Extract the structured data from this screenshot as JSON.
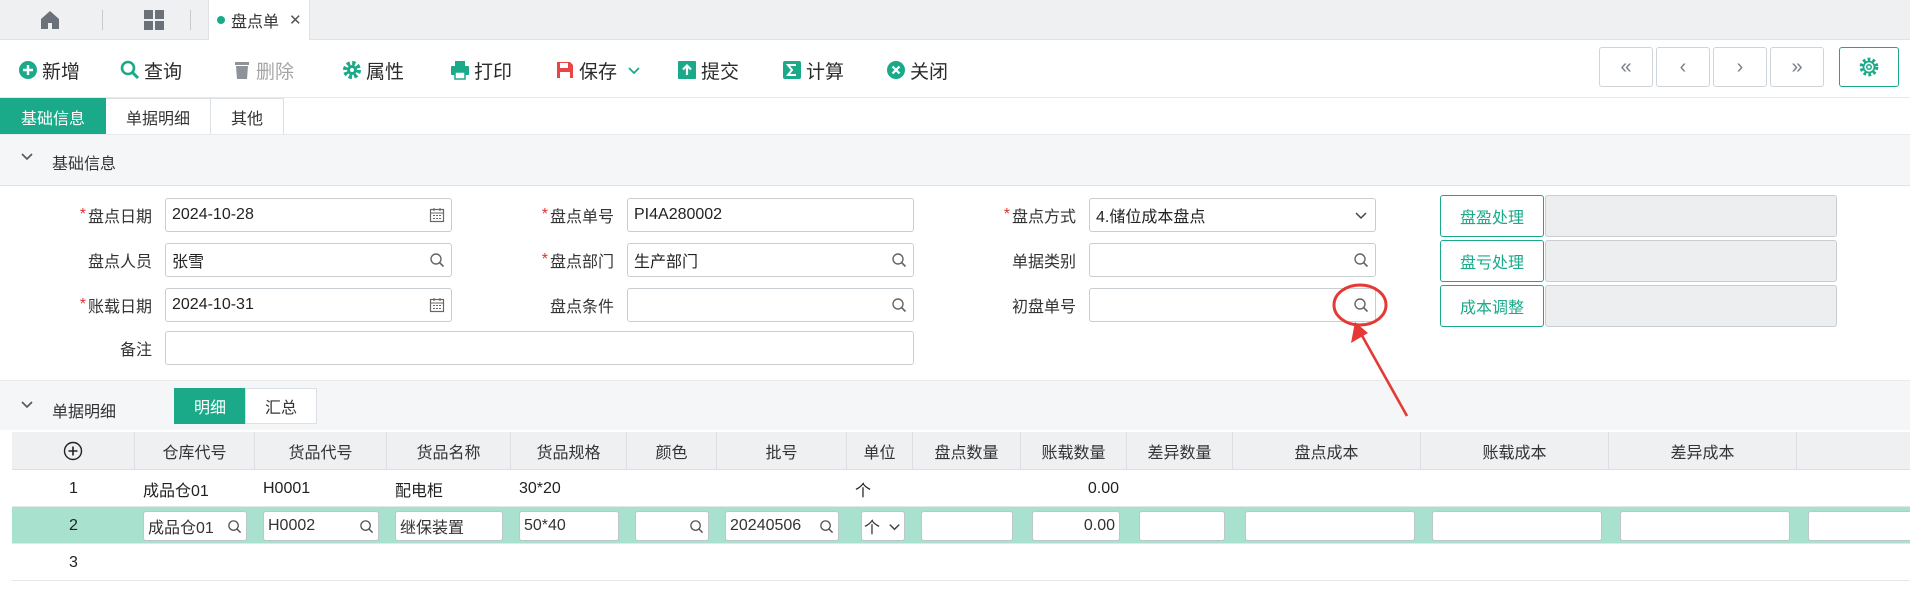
{
  "tabs": {
    "page_tab_label": "盘点单",
    "home_icon": "home-icon",
    "apps_icon": "grid-icon",
    "close_icon": "close-icon"
  },
  "toolbar": {
    "new": "新增",
    "query": "查询",
    "delete": "删除",
    "properties": "属性",
    "print": "打印",
    "save": "保存",
    "submit": "提交",
    "calculate": "计算",
    "close": "关闭",
    "nav": [
      "«",
      "‹",
      "›",
      "»"
    ]
  },
  "section_tabs": [
    "基础信息",
    "单据明细",
    "其他"
  ],
  "basic": {
    "title": "基础信息",
    "fields": {
      "count_date": {
        "label": "盘点日期",
        "value": "2024-10-28"
      },
      "count_staff": {
        "label": "盘点人员",
        "value": "张雪"
      },
      "book_date": {
        "label": "账载日期",
        "value": "2024-10-31"
      },
      "remark": {
        "label": "备注",
        "value": ""
      },
      "count_no": {
        "label": "盘点单号",
        "value": "PI4A280002"
      },
      "count_dept": {
        "label": "盘点部门",
        "value": "生产部门"
      },
      "count_cond": {
        "label": "盘点条件",
        "value": ""
      },
      "count_mode": {
        "label": "盘点方式",
        "value": "4.储位成本盘点"
      },
      "doc_type": {
        "label": "单据类别",
        "value": ""
      },
      "initial_no": {
        "label": "初盘单号",
        "value": ""
      }
    },
    "buttons": {
      "surplus": "盘盈处理",
      "loss": "盘亏处理",
      "cost_adjust": "成本调整"
    }
  },
  "detail": {
    "title": "单据明细",
    "subtabs": [
      "明细",
      "汇总"
    ],
    "columns": [
      "仓库代号",
      "货品代号",
      "货品名称",
      "货品规格",
      "颜色",
      "批号",
      "单位",
      "盘点数量",
      "账载数量",
      "差异数量",
      "盘点成本",
      "账载成本",
      "差异成本"
    ],
    "rows": [
      {
        "no": "1",
        "warehouse": "成品仓01",
        "item_code": "H0001",
        "item_name": "配电柜",
        "spec": "30*20",
        "color": "",
        "batch": "",
        "unit": "个",
        "count_qty": "",
        "book_qty": "0.00"
      },
      {
        "no": "2",
        "warehouse": "成品仓01",
        "item_code": "H0002",
        "item_name": "继保装置",
        "spec": "50*40",
        "color": "",
        "batch": "20240506",
        "unit": "个",
        "count_qty": "",
        "book_qty": "0.00"
      },
      {
        "no": "3"
      }
    ]
  },
  "colors": {
    "accent": "#1aaa8a",
    "selected_row": "#a8e2cf",
    "annotation": "#e53935"
  }
}
